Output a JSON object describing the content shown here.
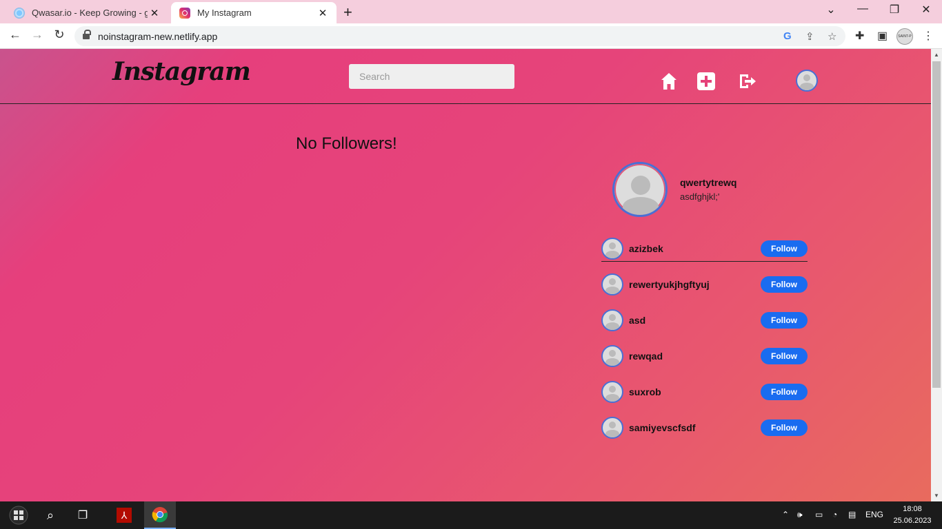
{
  "browser": {
    "tabs": [
      {
        "title": "Qwasar.io - Keep Growing - gulm",
        "close": "✕"
      },
      {
        "title": "My Instagram",
        "close": "✕"
      }
    ],
    "new_tab": "+",
    "window_controls": {
      "minimize": "—",
      "restore": "❐",
      "close": "✕",
      "tab_search": "⌄"
    },
    "url": "noinstagram-new.netlify.app",
    "profile_chip": "SAINT-P"
  },
  "app": {
    "logo": "Instagram",
    "search_placeholder": "Search",
    "nav_icons": [
      "home-icon",
      "add-post-icon",
      "logout-icon",
      "profile-avatar"
    ]
  },
  "feed": {
    "empty_message": "No Followers!"
  },
  "profile": {
    "username": "qwertytrewq",
    "bio": "asdfghjkl;'"
  },
  "suggestions": [
    {
      "username": "azizbek",
      "button": "Follow"
    },
    {
      "username": "rewertyukjhgftyuj",
      "button": "Follow"
    },
    {
      "username": "asd",
      "button": "Follow"
    },
    {
      "username": "rewqad",
      "button": "Follow"
    },
    {
      "username": "suxrob",
      "button": "Follow"
    },
    {
      "username": "samiyevscfsdf",
      "button": "Follow"
    }
  ],
  "taskbar": {
    "language": "ENG",
    "time": "18:08",
    "date": "25.06.2023"
  },
  "colors": {
    "follow_button": "#1a6cf0",
    "avatar_ring": "#4a6fd4",
    "page_gradient_start": "#c9538d",
    "page_gradient_end": "#e86b5e"
  }
}
